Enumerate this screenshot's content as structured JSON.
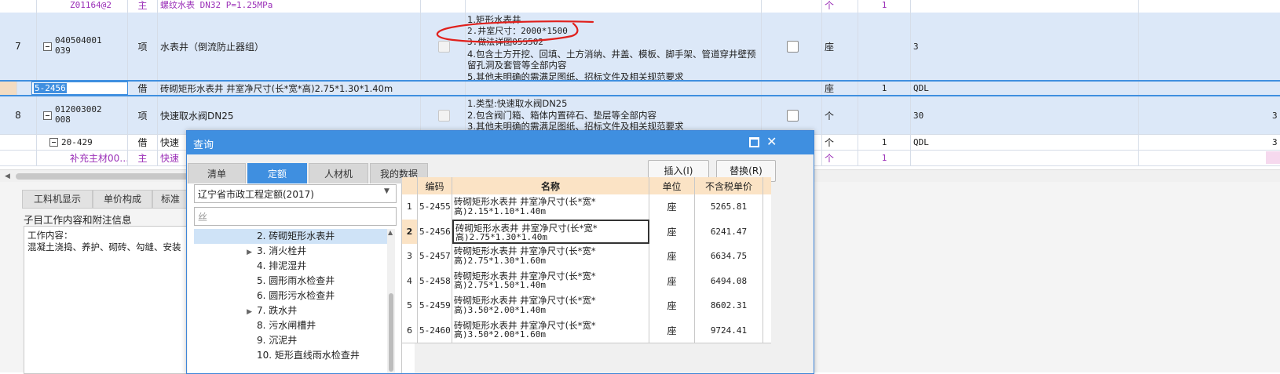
{
  "grid": {
    "rows": [
      {
        "num": "",
        "code": "Z01164@2",
        "type": "主",
        "name": "螺纹水表  DN32 P=1.25MPa",
        "unit": "个",
        "qty": "1",
        "extra": ""
      },
      {
        "num": "7",
        "code": "040504001039",
        "type": "项",
        "name": "水表井（倒流防止器组）",
        "features": [
          "1.矩形水表井",
          "2.井室尺寸：2000*1500",
          "3.做法详图05S502",
          "4.包含土方开挖、回填、土方消纳、井盖、模板、脚手架、管道穿井壁预留孔洞及套管等全部内容",
          "5.其他未明确的需满足图纸、招标文件及相关规范要求"
        ],
        "unit": "座",
        "qty": "",
        "extra": "3"
      },
      {
        "num": "",
        "code": "5-2456",
        "type": "借",
        "name": "砖砌矩形水表井 井室净尺寸(长*宽*高)2.75*1.30*1.40m",
        "unit": "座",
        "qty": "1",
        "extra": "QDL"
      },
      {
        "num": "8",
        "code": "012003002008",
        "type": "项",
        "name": "快速取水阀DN25",
        "features": [
          "1.类型:快速取水阀DN25",
          "2.包含阀门箱、箱体内置碎石、垫层等全部内容",
          "3.其他未明确的需满足图纸、招标文件及相关规范要求"
        ],
        "unit": "个",
        "qty": "",
        "extra": "30"
      },
      {
        "num": "",
        "code": "20-429",
        "type": "借",
        "name": "快速",
        "unit": "个",
        "qty": "1",
        "extra": "QDL"
      },
      {
        "num": "",
        "code": "补充主材00…",
        "type": "主",
        "name": "快速",
        "unit": "个",
        "qty": "1",
        "extra": ""
      }
    ],
    "right_edge_digit": "3"
  },
  "lower_tabs": [
    "工料机显示",
    "单价构成",
    "标准"
  ],
  "info": {
    "title": "子目工作内容和附注信息",
    "work_label": "工作内容：",
    "work_text": "混凝土浇捣、养护、砌砖、勾缝、安装"
  },
  "dialog": {
    "title": "查询",
    "tabs": [
      "清单",
      "定额",
      "人材机",
      "我的数据"
    ],
    "active_tab": "定额",
    "insert_button": "插入(I)",
    "replace_button": "替换(R)",
    "quota_select": "辽宁省市政工程定额(2017)",
    "search_value": "丝",
    "tree": [
      {
        "label": "2. 砖砌矩形水表井",
        "selected": true,
        "arrow": false
      },
      {
        "label": "3. 消火栓井",
        "selected": false,
        "arrow": true
      },
      {
        "label": "4. 排泥湿井",
        "selected": false,
        "arrow": false
      },
      {
        "label": "5. 圆形雨水检查井",
        "selected": false,
        "arrow": false
      },
      {
        "label": "6. 圆形污水检查井",
        "selected": false,
        "arrow": false
      },
      {
        "label": "7. 跌水井",
        "selected": false,
        "arrow": true
      },
      {
        "label": "8. 污水闸槽井",
        "selected": false,
        "arrow": false
      },
      {
        "label": "9. 沉泥井",
        "selected": false,
        "arrow": false
      },
      {
        "label": "10. 矩形直线雨水检查井",
        "selected": false,
        "arrow": false
      }
    ],
    "table": {
      "headers": {
        "code": "编码",
        "name": "名称",
        "unit": "单位",
        "price": "不含税单价"
      },
      "rows": [
        {
          "idx": "1",
          "code": "5-2455",
          "name1": "砖砌矩形水表井 井室净尺寸(长*宽*",
          "name2": "高)2.15*1.10*1.40m",
          "unit": "座",
          "price": "5265.81"
        },
        {
          "idx": "2",
          "code": "5-2456",
          "name1": "砖砌矩形水表井 井室净尺寸(长*宽*",
          "name2": "高)2.75*1.30*1.40m",
          "unit": "座",
          "price": "6241.47"
        },
        {
          "idx": "3",
          "code": "5-2457",
          "name1": "砖砌矩形水表井 井室净尺寸(长*宽*",
          "name2": "高)2.75*1.30*1.60m",
          "unit": "座",
          "price": "6634.75"
        },
        {
          "idx": "4",
          "code": "5-2458",
          "name1": "砖砌矩形水表井 井室净尺寸(长*宽*",
          "name2": "高)2.75*1.50*1.40m",
          "unit": "座",
          "price": "6494.08"
        },
        {
          "idx": "5",
          "code": "5-2459",
          "name1": "砖砌矩形水表井 井室净尺寸(长*宽*",
          "name2": "高)3.50*2.00*1.40m",
          "unit": "座",
          "price": "8602.31"
        },
        {
          "idx": "6",
          "code": "5-2460",
          "name1": "砖砌矩形水表井 井室净尺寸(长*宽*",
          "name2": "高)3.50*2.00*1.60m",
          "unit": "座",
          "price": "9724.41"
        }
      ]
    }
  },
  "colors": {
    "accent": "#3f8fe0",
    "selected_row": "#dce8f8",
    "annotation": "#e0201c",
    "purple_text": "#9b30b8"
  }
}
